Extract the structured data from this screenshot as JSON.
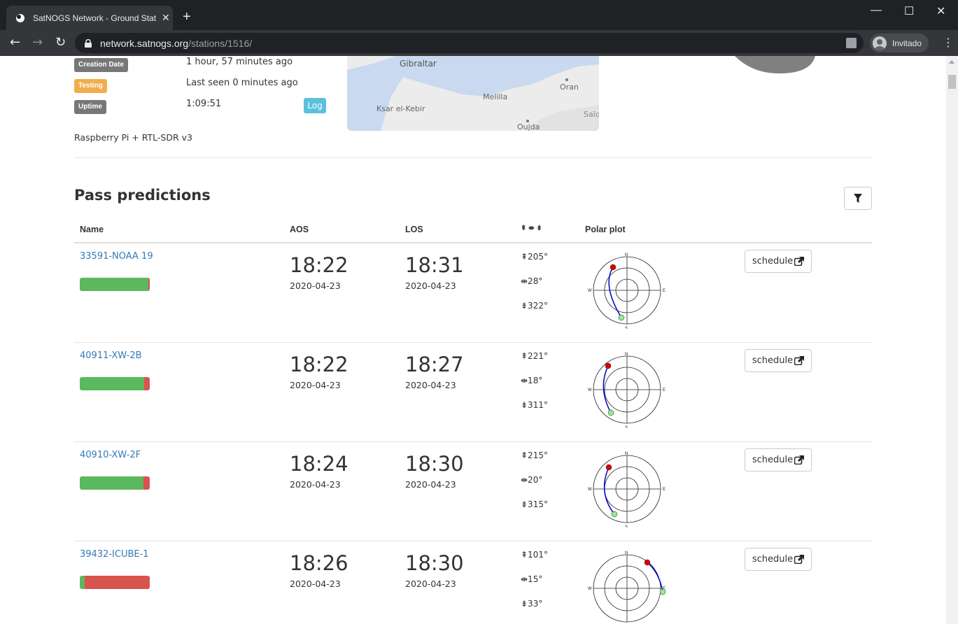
{
  "browser": {
    "tab_title": "SatNOGS Network - Ground Station",
    "new_tab": "+",
    "url_host": "network.satnogs.org",
    "url_path": "/stations/1516/",
    "profile_name": "Invitado",
    "window_controls": {
      "minimize": "—",
      "maximize": "☐",
      "close": "✕"
    }
  },
  "station": {
    "creation_label": "Creation Date",
    "creation_value": "1 hour, 57 minutes ago",
    "status_label": "Testing",
    "status_value": "Last seen 0 minutes ago",
    "uptime_label": "Uptime",
    "uptime_value": "1:09:51",
    "log_button": "Log",
    "hardware": "Raspberry Pi + RTL-SDR v3",
    "map_labels": {
      "gibraltar": "Gibraltar",
      "oran": "Oran",
      "melilla": "Melilla",
      "ksar": "Ksar el-Kebir",
      "oujda": "Oujda",
      "said": "Saïd"
    }
  },
  "passes": {
    "title": "Pass predictions",
    "headers": {
      "name": "Name",
      "aos": "AOS",
      "los": "LOS",
      "angles": "⇞ ⇼ ⇟",
      "polar": "Polar plot"
    },
    "schedule_label": "schedule",
    "colors": {
      "good": "#5cb85c",
      "bad": "#d9534f",
      "link": "#337ab7",
      "track": "#0000cc",
      "start": "#dd0000",
      "end": "#90ee90"
    },
    "rows": [
      {
        "name": "33591-NOAA 19",
        "aos_time": "18:22",
        "aos_date": "2020-04-23",
        "los_time": "18:31",
        "los_date": "2020-04-23",
        "az_rise": "⇞205°",
        "max_el": "⇼28°",
        "az_set": "⇟322°",
        "success_fraction": 0.98
      },
      {
        "name": "40911-XW-2B",
        "aos_time": "18:22",
        "aos_date": "2020-04-23",
        "los_time": "18:27",
        "los_date": "2020-04-23",
        "az_rise": "⇞221°",
        "max_el": "⇼18°",
        "az_set": "⇟311°",
        "success_fraction": 0.92
      },
      {
        "name": "40910-XW-2F",
        "aos_time": "18:24",
        "aos_date": "2020-04-23",
        "los_time": "18:30",
        "los_date": "2020-04-23",
        "az_rise": "⇞215°",
        "max_el": "⇼20°",
        "az_set": "⇟315°",
        "success_fraction": 0.91
      },
      {
        "name": "39432-ICUBE-1",
        "aos_time": "18:26",
        "aos_date": "2020-04-23",
        "los_time": "18:30",
        "los_date": "2020-04-23",
        "az_rise": "⇞101°",
        "max_el": "⇼15°",
        "az_set": "⇟33°",
        "success_fraction": 0.07
      }
    ]
  }
}
